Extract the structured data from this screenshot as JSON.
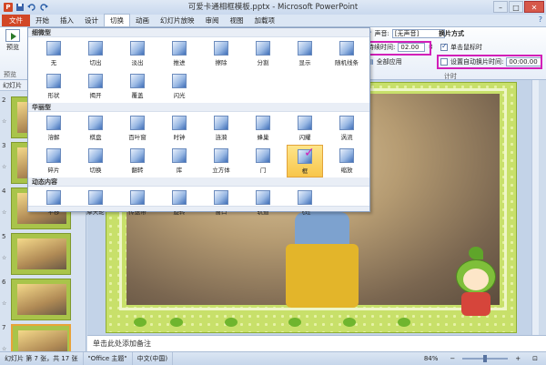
{
  "window": {
    "title": "可爱卡通相框模板.pptx - Microsoft PowerPoint",
    "minimize": "–",
    "maximize": "□",
    "close": "✕"
  },
  "quick_access": [
    "save-icon",
    "undo-icon",
    "redo-icon"
  ],
  "tabs": [
    {
      "label": "文件",
      "kind": "file"
    },
    {
      "label": "开始",
      "kind": "normal"
    },
    {
      "label": "插入",
      "kind": "normal"
    },
    {
      "label": "设计",
      "kind": "normal"
    },
    {
      "label": "切换",
      "kind": "active"
    },
    {
      "label": "动画",
      "kind": "normal"
    },
    {
      "label": "幻灯片放映",
      "kind": "normal"
    },
    {
      "label": "审阅",
      "kind": "normal"
    },
    {
      "label": "视图",
      "kind": "normal"
    },
    {
      "label": "加载项",
      "kind": "normal"
    }
  ],
  "ribbon": {
    "preview_label": "预览",
    "preview_group": "预览",
    "sound_label": "声音:",
    "sound_value": "[无声音]",
    "duration_label": "持续时间:",
    "duration_value": "02.00",
    "apply_all": "全部应用",
    "advance_header": "换片方式",
    "on_click_label": "单击鼠标时",
    "on_click_checked": true,
    "after_label": "设置自动换片时间:",
    "after_value": "00:00.00",
    "after_checked": false,
    "timing_group": "计时"
  },
  "gallery": {
    "sections": [
      {
        "title": "细微型",
        "items": [
          {
            "label": "无",
            "icon": "none-icon"
          },
          {
            "label": "切出",
            "icon": "cut-icon"
          },
          {
            "label": "淡出",
            "icon": "fade-icon"
          },
          {
            "label": "推进",
            "icon": "push-icon"
          },
          {
            "label": "擦除",
            "icon": "wipe-icon"
          },
          {
            "label": "分割",
            "icon": "split-icon"
          },
          {
            "label": "显示",
            "icon": "reveal-icon"
          },
          {
            "label": "随机线条",
            "icon": "random-bars-icon"
          },
          {
            "label": "形状",
            "icon": "shape-icon"
          },
          {
            "label": "揭开",
            "icon": "uncover-icon"
          },
          {
            "label": "覆盖",
            "icon": "cover-icon"
          },
          {
            "label": "闪光",
            "icon": "flash-icon"
          }
        ]
      },
      {
        "title": "华丽型",
        "items": [
          {
            "label": "溶解",
            "icon": "dissolve-icon"
          },
          {
            "label": "棋盘",
            "icon": "checkerboard-icon"
          },
          {
            "label": "百叶窗",
            "icon": "blinds-icon"
          },
          {
            "label": "时钟",
            "icon": "clock-icon"
          },
          {
            "label": "涟漪",
            "icon": "ripple-icon"
          },
          {
            "label": "蜂巢",
            "icon": "honeycomb-icon"
          },
          {
            "label": "闪耀",
            "icon": "glitter-icon"
          },
          {
            "label": "涡流",
            "icon": "vortex-icon"
          },
          {
            "label": "碎片",
            "icon": "shred-icon"
          },
          {
            "label": "切换",
            "icon": "switch-icon"
          },
          {
            "label": "翻转",
            "icon": "flip-icon"
          },
          {
            "label": "库",
            "icon": "gallery-icon"
          },
          {
            "label": "立方体",
            "icon": "cube-icon"
          },
          {
            "label": "门",
            "icon": "doors-icon"
          },
          {
            "label": "框",
            "icon": "box-icon",
            "selected": true
          },
          {
            "label": "缩放",
            "icon": "zoom-icon"
          }
        ]
      },
      {
        "title": "动态内容",
        "items": [
          {
            "label": "平移",
            "icon": "pan-icon"
          },
          {
            "label": "摩天轮",
            "icon": "ferris-wheel-icon"
          },
          {
            "label": "传送带",
            "icon": "conveyor-icon"
          },
          {
            "label": "旋转",
            "icon": "rotate-icon"
          },
          {
            "label": "窗口",
            "icon": "window-icon"
          },
          {
            "label": "轨道",
            "icon": "orbit-icon"
          },
          {
            "label": "飞过",
            "icon": "fly-through-icon"
          }
        ]
      }
    ]
  },
  "left_panel": {
    "tab_label": "幻灯片",
    "thumbs": [
      {
        "num": "2"
      },
      {
        "num": "3"
      },
      {
        "num": "4"
      },
      {
        "num": "5"
      },
      {
        "num": "6"
      },
      {
        "num": "7",
        "selected": true
      }
    ]
  },
  "notes": {
    "placeholder": "单击此处添加备注"
  },
  "status": {
    "slide_info": "幻灯片 第 7 张，共 17 张",
    "theme": "\"Office 主题\"",
    "language": "中文(中国)",
    "zoom": "84%",
    "zoom_level": 0.5
  },
  "colors": {
    "file_tab": "#d24726",
    "highlight": "#d21fb8",
    "slide_bg": "#c8e06a"
  }
}
